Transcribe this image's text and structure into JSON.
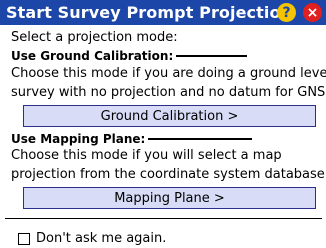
{
  "title_bar": {
    "title": "Start Survey Prompt Projection",
    "help_symbol": "?",
    "close_symbol": "×",
    "colors": {
      "bar": "#1c46a8",
      "help": "#f5c400",
      "close": "#e02020"
    }
  },
  "prompt": "Select a projection mode:",
  "ground_calibration": {
    "heading": "Use Ground Calibration:",
    "line1": "Choose this mode if you are doing a ground level",
    "line2": "survey with no projection and no datum for GNSS",
    "button_label": "Ground Calibration >"
  },
  "mapping_plane": {
    "heading": "Use Mapping Plane:",
    "line1": "Choose this mode if you will select a map",
    "line2": "projection from the coordinate system database.",
    "button_label": "Mapping Plane >"
  },
  "dont_ask": {
    "label": "Don't ask me again.",
    "checked": false
  },
  "colors": {
    "button_fill": "#d8dcf6",
    "button_border": "#2a2f8c"
  }
}
